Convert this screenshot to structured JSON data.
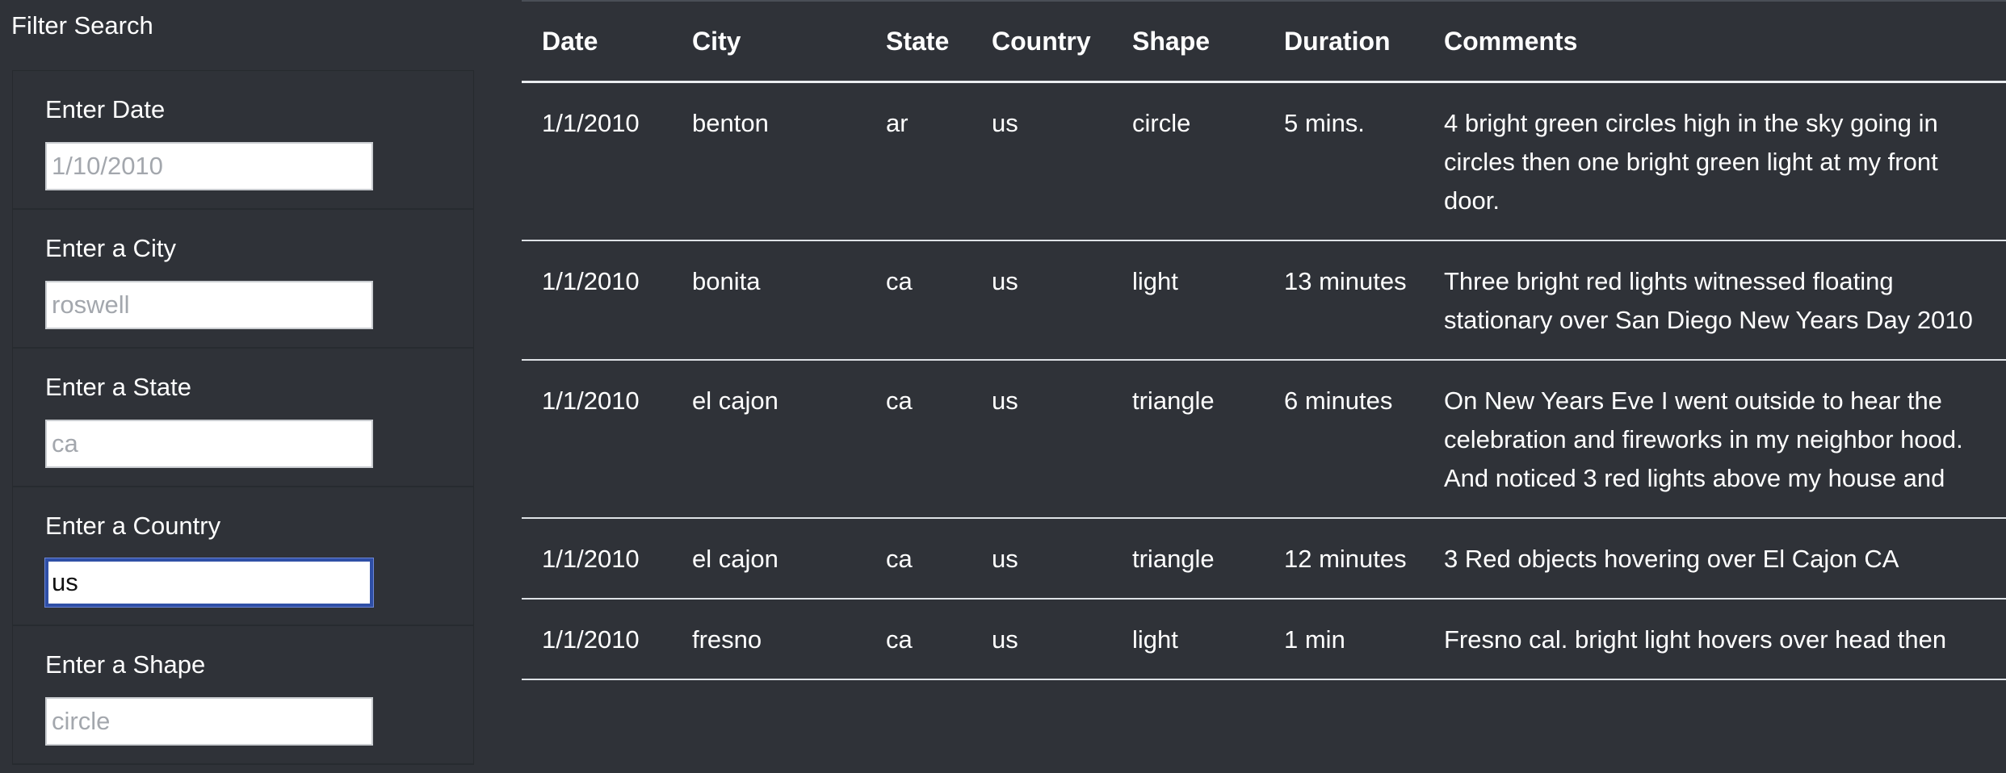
{
  "sidebar": {
    "title": "Filter Search",
    "filters": [
      {
        "label": "Enter Date",
        "placeholder": "1/10/2010",
        "value": ""
      },
      {
        "label": "Enter a City",
        "placeholder": "roswell",
        "value": ""
      },
      {
        "label": "Enter a State",
        "placeholder": "ca",
        "value": ""
      },
      {
        "label": "Enter a Country",
        "placeholder": "",
        "value": "us"
      },
      {
        "label": "Enter a Shape",
        "placeholder": "circle",
        "value": ""
      }
    ]
  },
  "table": {
    "headers": [
      "Date",
      "City",
      "State",
      "Country",
      "Shape",
      "Duration",
      "Comments"
    ],
    "rows": [
      [
        "1/1/2010",
        "benton",
        "ar",
        "us",
        "circle",
        "5 mins.",
        "4 bright green circles high in the sky going in circles then one bright green light at my front door."
      ],
      [
        "1/1/2010",
        "bonita",
        "ca",
        "us",
        "light",
        "13 minutes",
        "Three bright red lights witnessed floating stationary over San Diego New Years Day 2010"
      ],
      [
        "1/1/2010",
        "el cajon",
        "ca",
        "us",
        "triangle",
        "6 minutes",
        "On New Years Eve I went outside to hear the celebration and fireworks in my neighbor hood. And noticed 3 red lights above my house and"
      ],
      [
        "1/1/2010",
        "el cajon",
        "ca",
        "us",
        "triangle",
        "12 minutes",
        "3 Red objects hovering over El Cajon CA"
      ],
      [
        "1/1/2010",
        "fresno",
        "ca",
        "us",
        "light",
        "1 min",
        "Fresno cal. bright light hovers over head then"
      ]
    ]
  },
  "colors": {
    "background": "#2f3238",
    "focus_border": "#2f4fa6",
    "header_rule": "#e9ecef"
  }
}
